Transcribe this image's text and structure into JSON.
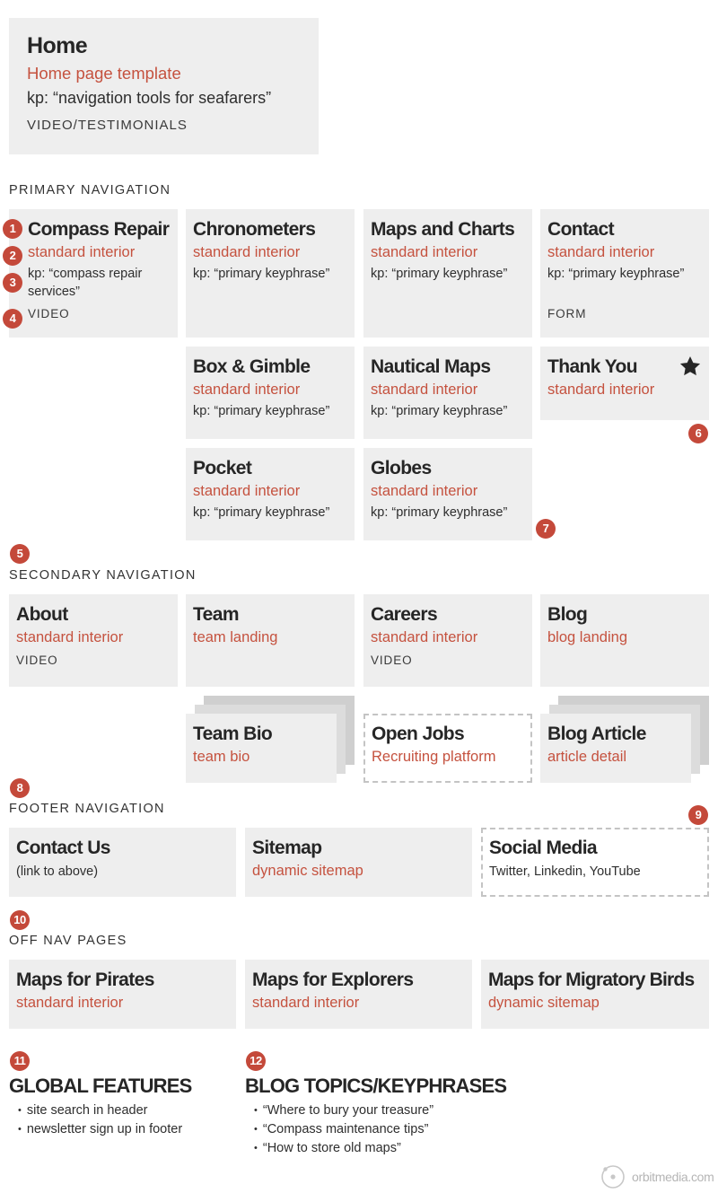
{
  "colors": {
    "accent": "#c5523f",
    "badge": "#c4493a",
    "box_fill": "#eeeeee",
    "dashed_border": "#c4c4c4",
    "text_dark": "#262626"
  },
  "home": {
    "title": "Home",
    "template": "Home page template",
    "keyphrase": "kp: “navigation tools for seafarers”",
    "tag": "VIDEO/TESTIMONIALS"
  },
  "primary": {
    "label": "PRIMARY NAVIGATION",
    "pages": [
      {
        "title": "Compass Repair",
        "template": "standard interior",
        "keyphrase": "kp: “compass repair services”",
        "tag": "VIDEO"
      },
      {
        "title": "Chronometers",
        "template": "standard interior",
        "keyphrase": "kp: “primary keyphrase”"
      },
      {
        "title": "Maps and Charts",
        "template": "standard interior",
        "keyphrase": "kp: “primary keyphrase”"
      },
      {
        "title": "Contact",
        "template": "standard interior",
        "keyphrase": "kp: “primary keyphrase”",
        "tag": "FORM"
      },
      {
        "title": "Box & Gimble",
        "template": "standard interior",
        "keyphrase": "kp: “primary keyphrase”"
      },
      {
        "title": "Nautical Maps",
        "template": "standard interior",
        "keyphrase": "kp: “primary keyphrase”"
      },
      {
        "title": "Thank You",
        "template": "standard interior",
        "icon": "star-icon"
      },
      {
        "title": "Pocket",
        "template": "standard interior",
        "keyphrase": "kp: “primary keyphrase”"
      },
      {
        "title": "Globes",
        "template": "standard interior",
        "keyphrase": "kp: “primary keyphrase”"
      }
    ]
  },
  "secondary": {
    "label": "SECONDARY NAVIGATION",
    "pages": [
      {
        "title": "About",
        "template": "standard interior",
        "tag": "VIDEO"
      },
      {
        "title": "Team",
        "template": "team landing"
      },
      {
        "title": "Careers",
        "template": "standard interior",
        "tag": "VIDEO"
      },
      {
        "title": "Blog",
        "template": "blog landing"
      },
      {
        "title": "Team Bio",
        "template": "team bio"
      },
      {
        "title": "Open Jobs",
        "template": "Recruiting platform"
      },
      {
        "title": "Blog Article",
        "template": "article detail"
      }
    ]
  },
  "footer_nav": {
    "label": "FOOTER NAVIGATION",
    "pages": [
      {
        "title": "Contact Us",
        "note": "(link to above)"
      },
      {
        "title": "Sitemap",
        "template": "dynamic sitemap"
      },
      {
        "title": "Social Media",
        "note": "Twitter, Linkedin, YouTube"
      }
    ]
  },
  "off_nav": {
    "label": "OFF NAV PAGES",
    "pages": [
      {
        "title": "Maps for Pirates",
        "template": "standard interior"
      },
      {
        "title": "Maps for Explorers",
        "template": "standard interior"
      },
      {
        "title": "Maps for Migratory Birds",
        "template": "dynamic sitemap"
      }
    ]
  },
  "global_features": {
    "heading": "GLOBAL FEATURES",
    "items": [
      "site search in header",
      "newsletter sign up in footer"
    ]
  },
  "blog_topics": {
    "heading": "BLOG TOPICS/KEYPHRASES",
    "items": [
      "“Where to bury your treasure”",
      "“Compass maintenance tips”",
      "“How to store old maps”"
    ]
  },
  "badges": [
    "1",
    "2",
    "3",
    "4",
    "5",
    "6",
    "7",
    "8",
    "9",
    "10",
    "11",
    "12"
  ],
  "credit": "orbitmedia.com"
}
